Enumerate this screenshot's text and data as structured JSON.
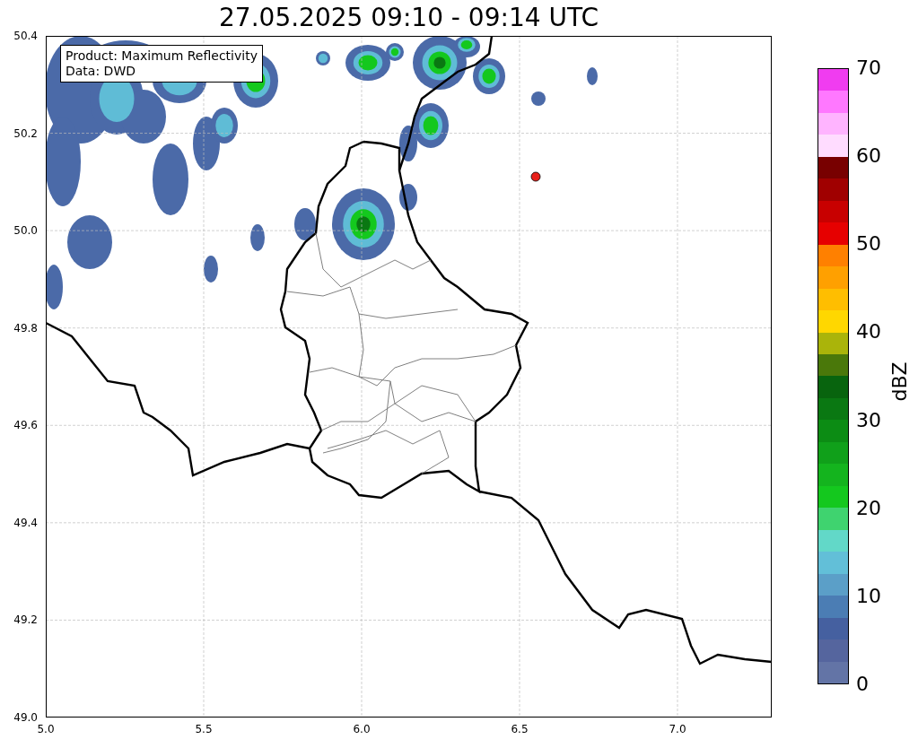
{
  "title": "27.05.2025 09:10 - 09:14 UTC",
  "legend": {
    "lines": [
      "Product: Maximum Reflectivity",
      "Data: DWD"
    ]
  },
  "map": {
    "xticks": [
      "5.0",
      "5.5",
      "6.0",
      "6.5",
      "7.0"
    ],
    "yticks": [
      "50.4",
      "50.2",
      "50.0",
      "49.8",
      "49.6",
      "49.4",
      "49.2",
      "49.0"
    ]
  },
  "colorbar": {
    "label": "dBZ",
    "ticks": [
      "70",
      "60",
      "50",
      "40",
      "30",
      "20",
      "10",
      "0"
    ],
    "bands": [
      {
        "color": "#6374a6"
      },
      {
        "color": "#55659e"
      },
      {
        "color": "#4560a0"
      },
      {
        "color": "#4b7db4"
      },
      {
        "color": "#5b9fc8"
      },
      {
        "color": "#62bfd8"
      },
      {
        "color": "#62d8c8"
      },
      {
        "color": "#3fd36f"
      },
      {
        "color": "#14c81e"
      },
      {
        "color": "#14b41e"
      },
      {
        "color": "#10a01a"
      },
      {
        "color": "#0c8c14"
      },
      {
        "color": "#0a7812"
      },
      {
        "color": "#08640e"
      },
      {
        "color": "#4a780a"
      },
      {
        "color": "#aab40a"
      },
      {
        "color": "#ffd700"
      },
      {
        "color": "#ffbe00"
      },
      {
        "color": "#ffa000"
      },
      {
        "color": "#ff8000"
      },
      {
        "color": "#e60000"
      },
      {
        "color": "#c80000"
      },
      {
        "color": "#a00000"
      },
      {
        "color": "#780000"
      },
      {
        "color": "#ffdcff"
      },
      {
        "color": "#ffb4ff"
      },
      {
        "color": "#ff78ff"
      },
      {
        "color": "#f03cf0"
      }
    ]
  }
}
